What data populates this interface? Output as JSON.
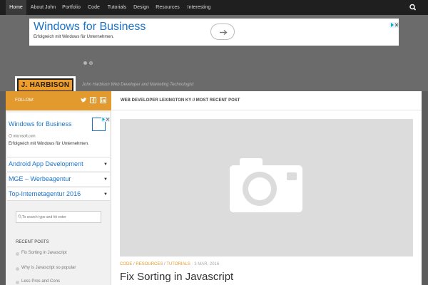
{
  "nav": {
    "items": [
      {
        "label": "Home",
        "active": true
      },
      {
        "label": "About John",
        "active": false
      },
      {
        "label": "Portfolio",
        "active": false
      },
      {
        "label": "Code",
        "active": false
      },
      {
        "label": "Tutorials",
        "active": false
      },
      {
        "label": "Design",
        "active": false
      },
      {
        "label": "Resources",
        "active": false
      },
      {
        "label": "Interesting",
        "active": false
      }
    ],
    "search_icon": "search-icon"
  },
  "header_ad": {
    "title": "Windows for Business",
    "description": "Erfolgreich mit Windows für Unternehmen."
  },
  "site": {
    "logo_text": "J. HARBISON",
    "tagline": "John Harbison Web Developer and Marketing Technologist"
  },
  "sidebar": {
    "follow_label": "FOLLOW:",
    "social_icons": [
      "twitter-icon",
      "facebook-icon",
      "linkedin-icon"
    ],
    "ad": {
      "title": "Windows for Business",
      "domain": "microsoft.com",
      "description": "Erfolgreich mit Windows für Unternehmen."
    },
    "links": [
      {
        "label": "Android App Development"
      },
      {
        "label": "MGE – Werbeagentur"
      },
      {
        "label": "Top-Internetagentur 2016"
      }
    ],
    "search_placeholder": "To search type and hit enter",
    "recent_title": "RECENT POSTS",
    "recent_posts": [
      {
        "title": "Fix Sorting in Javascript"
      },
      {
        "title": "Why is Javascript so popular"
      },
      {
        "title": "Less Pros and Cons"
      }
    ]
  },
  "content": {
    "header": "WEB DEVELOPER LEXINGTON KY // MOST RECENT POST",
    "categories": [
      "CODE",
      "RESOURCES",
      "TUTORIALS"
    ],
    "date": "3 MAR, 2016",
    "post_title": "Fix Sorting in Javascript"
  },
  "colors": {
    "accent": "#e29a2f",
    "link": "#1a73c8",
    "nav_bg": "#1f1f1f"
  }
}
